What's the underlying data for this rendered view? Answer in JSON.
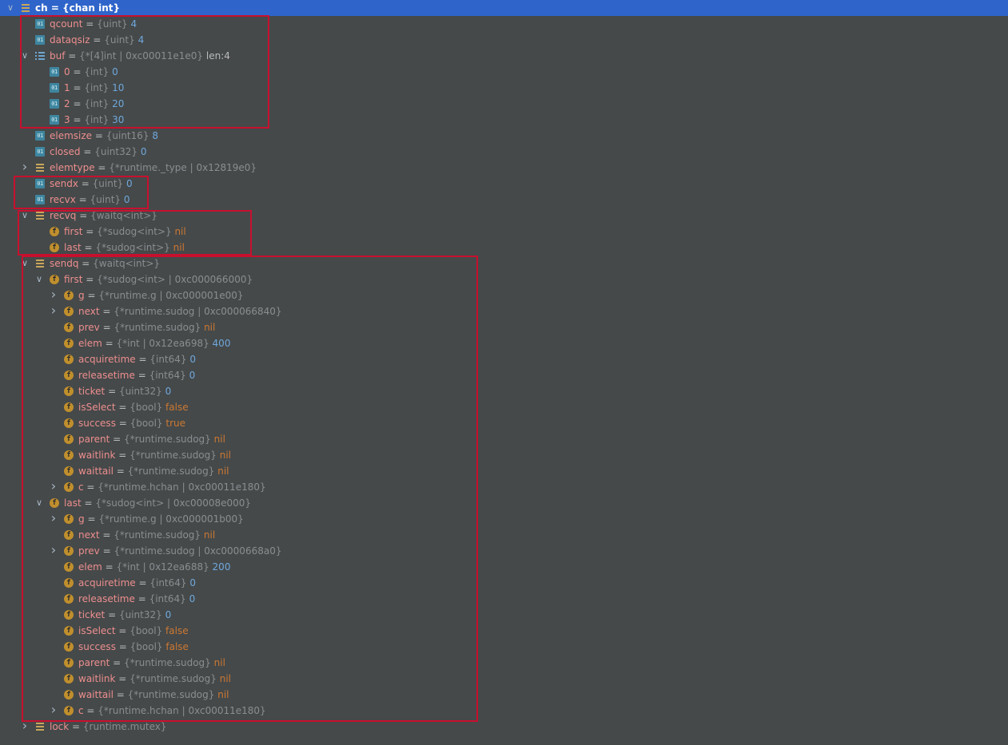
{
  "tree": [
    {
      "d": 0,
      "exp": "open",
      "icon": "obj",
      "name": "ch",
      "type": "{chan int}",
      "val": "",
      "vt": "",
      "sel": true
    },
    {
      "d": 1,
      "exp": "none",
      "icon": "prim",
      "name": "qcount",
      "type": "{uint}",
      "val": "4",
      "vt": "num"
    },
    {
      "d": 1,
      "exp": "none",
      "icon": "prim",
      "name": "dataqsiz",
      "type": "{uint}",
      "val": "4",
      "vt": "num"
    },
    {
      "d": 1,
      "exp": "open",
      "icon": "arr",
      "name": "buf",
      "type": "{*[4]int | 0xc00011e1e0}",
      "val": "len:4",
      "vt": "plain"
    },
    {
      "d": 2,
      "exp": "none",
      "icon": "prim",
      "name": "0",
      "type": "{int}",
      "val": "0",
      "vt": "num"
    },
    {
      "d": 2,
      "exp": "none",
      "icon": "prim",
      "name": "1",
      "type": "{int}",
      "val": "10",
      "vt": "num"
    },
    {
      "d": 2,
      "exp": "none",
      "icon": "prim",
      "name": "2",
      "type": "{int}",
      "val": "20",
      "vt": "num"
    },
    {
      "d": 2,
      "exp": "none",
      "icon": "prim",
      "name": "3",
      "type": "{int}",
      "val": "30",
      "vt": "num"
    },
    {
      "d": 1,
      "exp": "none",
      "icon": "prim",
      "name": "elemsize",
      "type": "{uint16}",
      "val": "8",
      "vt": "num"
    },
    {
      "d": 1,
      "exp": "none",
      "icon": "prim",
      "name": "closed",
      "type": "{uint32}",
      "val": "0",
      "vt": "num"
    },
    {
      "d": 1,
      "exp": "closed",
      "icon": "obj",
      "name": "elemtype",
      "type": "{*runtime._type | 0x12819e0}",
      "val": "",
      "vt": ""
    },
    {
      "d": 1,
      "exp": "none",
      "icon": "prim",
      "name": "sendx",
      "type": "{uint}",
      "val": "0",
      "vt": "num"
    },
    {
      "d": 1,
      "exp": "none",
      "icon": "prim",
      "name": "recvx",
      "type": "{uint}",
      "val": "0",
      "vt": "num"
    },
    {
      "d": 1,
      "exp": "open",
      "icon": "obj",
      "name": "recvq",
      "type": "{waitq<int>}",
      "val": "",
      "vt": ""
    },
    {
      "d": 2,
      "exp": "none",
      "icon": "fld",
      "name": "first",
      "type": "{*sudog<int>}",
      "val": "nil",
      "vt": "kw"
    },
    {
      "d": 2,
      "exp": "none",
      "icon": "fld",
      "name": "last",
      "type": "{*sudog<int>}",
      "val": "nil",
      "vt": "kw"
    },
    {
      "d": 1,
      "exp": "open",
      "icon": "obj",
      "name": "sendq",
      "type": "{waitq<int>}",
      "val": "",
      "vt": ""
    },
    {
      "d": 2,
      "exp": "open",
      "icon": "fld",
      "name": "first",
      "type": "{*sudog<int> | 0xc000066000}",
      "val": "",
      "vt": ""
    },
    {
      "d": 3,
      "exp": "closed",
      "icon": "fld",
      "name": "g",
      "type": "{*runtime.g | 0xc000001e00}",
      "val": "",
      "vt": ""
    },
    {
      "d": 3,
      "exp": "closed",
      "icon": "fld",
      "name": "next",
      "type": "{*runtime.sudog | 0xc000066840}",
      "val": "",
      "vt": ""
    },
    {
      "d": 3,
      "exp": "none",
      "icon": "fld",
      "name": "prev",
      "type": "{*runtime.sudog}",
      "val": "nil",
      "vt": "kw"
    },
    {
      "d": 3,
      "exp": "none",
      "icon": "fld",
      "name": "elem",
      "type": "{*int | 0x12ea698}",
      "val": "400",
      "vt": "num"
    },
    {
      "d": 3,
      "exp": "none",
      "icon": "fld",
      "name": "acquiretime",
      "type": "{int64}",
      "val": "0",
      "vt": "num"
    },
    {
      "d": 3,
      "exp": "none",
      "icon": "fld",
      "name": "releasetime",
      "type": "{int64}",
      "val": "0",
      "vt": "num"
    },
    {
      "d": 3,
      "exp": "none",
      "icon": "fld",
      "name": "ticket",
      "type": "{uint32}",
      "val": "0",
      "vt": "num"
    },
    {
      "d": 3,
      "exp": "none",
      "icon": "fld",
      "name": "isSelect",
      "type": "{bool}",
      "val": "false",
      "vt": "kw"
    },
    {
      "d": 3,
      "exp": "none",
      "icon": "fld",
      "name": "success",
      "type": "{bool}",
      "val": "true",
      "vt": "kw"
    },
    {
      "d": 3,
      "exp": "none",
      "icon": "fld",
      "name": "parent",
      "type": "{*runtime.sudog}",
      "val": "nil",
      "vt": "kw"
    },
    {
      "d": 3,
      "exp": "none",
      "icon": "fld",
      "name": "waitlink",
      "type": "{*runtime.sudog}",
      "val": "nil",
      "vt": "kw"
    },
    {
      "d": 3,
      "exp": "none",
      "icon": "fld",
      "name": "waittail",
      "type": "{*runtime.sudog}",
      "val": "nil",
      "vt": "kw"
    },
    {
      "d": 3,
      "exp": "closed",
      "icon": "fld",
      "name": "c",
      "type": "{*runtime.hchan | 0xc00011e180}",
      "val": "",
      "vt": ""
    },
    {
      "d": 2,
      "exp": "open",
      "icon": "fld",
      "name": "last",
      "type": "{*sudog<int> | 0xc00008e000}",
      "val": "",
      "vt": ""
    },
    {
      "d": 3,
      "exp": "closed",
      "icon": "fld",
      "name": "g",
      "type": "{*runtime.g | 0xc000001b00}",
      "val": "",
      "vt": ""
    },
    {
      "d": 3,
      "exp": "none",
      "icon": "fld",
      "name": "next",
      "type": "{*runtime.sudog}",
      "val": "nil",
      "vt": "kw"
    },
    {
      "d": 3,
      "exp": "closed",
      "icon": "fld",
      "name": "prev",
      "type": "{*runtime.sudog | 0xc0000668a0}",
      "val": "",
      "vt": ""
    },
    {
      "d": 3,
      "exp": "none",
      "icon": "fld",
      "name": "elem",
      "type": "{*int | 0x12ea688}",
      "val": "200",
      "vt": "num"
    },
    {
      "d": 3,
      "exp": "none",
      "icon": "fld",
      "name": "acquiretime",
      "type": "{int64}",
      "val": "0",
      "vt": "num"
    },
    {
      "d": 3,
      "exp": "none",
      "icon": "fld",
      "name": "releasetime",
      "type": "{int64}",
      "val": "0",
      "vt": "num"
    },
    {
      "d": 3,
      "exp": "none",
      "icon": "fld",
      "name": "ticket",
      "type": "{uint32}",
      "val": "0",
      "vt": "num"
    },
    {
      "d": 3,
      "exp": "none",
      "icon": "fld",
      "name": "isSelect",
      "type": "{bool}",
      "val": "false",
      "vt": "kw"
    },
    {
      "d": 3,
      "exp": "none",
      "icon": "fld",
      "name": "success",
      "type": "{bool}",
      "val": "false",
      "vt": "kw"
    },
    {
      "d": 3,
      "exp": "none",
      "icon": "fld",
      "name": "parent",
      "type": "{*runtime.sudog}",
      "val": "nil",
      "vt": "kw"
    },
    {
      "d": 3,
      "exp": "none",
      "icon": "fld",
      "name": "waitlink",
      "type": "{*runtime.sudog}",
      "val": "nil",
      "vt": "kw"
    },
    {
      "d": 3,
      "exp": "none",
      "icon": "fld",
      "name": "waittail",
      "type": "{*runtime.sudog}",
      "val": "nil",
      "vt": "kw"
    },
    {
      "d": 3,
      "exp": "closed",
      "icon": "fld",
      "name": "c",
      "type": "{*runtime.hchan | 0xc00011e180}",
      "val": "",
      "vt": ""
    },
    {
      "d": 1,
      "exp": "closed",
      "icon": "obj",
      "name": "lock",
      "type": "{runtime.mutex}",
      "val": "",
      "vt": ""
    }
  ],
  "icons": {
    "prim": "primitive-field-icon",
    "arr": "array-icon",
    "obj": "object-icon",
    "fld": "field-icon"
  },
  "colors": {
    "background": "#45494a",
    "selection": "#2f65ca",
    "highlight_box": "#c8102e",
    "name": "#ee8e8e",
    "number": "#6fa8dc",
    "keyword": "#cc7832",
    "type": "#8a8e90",
    "prim_icon": "#3e86a0",
    "field_icon": "#c08f2d",
    "object_icon": "#c9a65b"
  }
}
